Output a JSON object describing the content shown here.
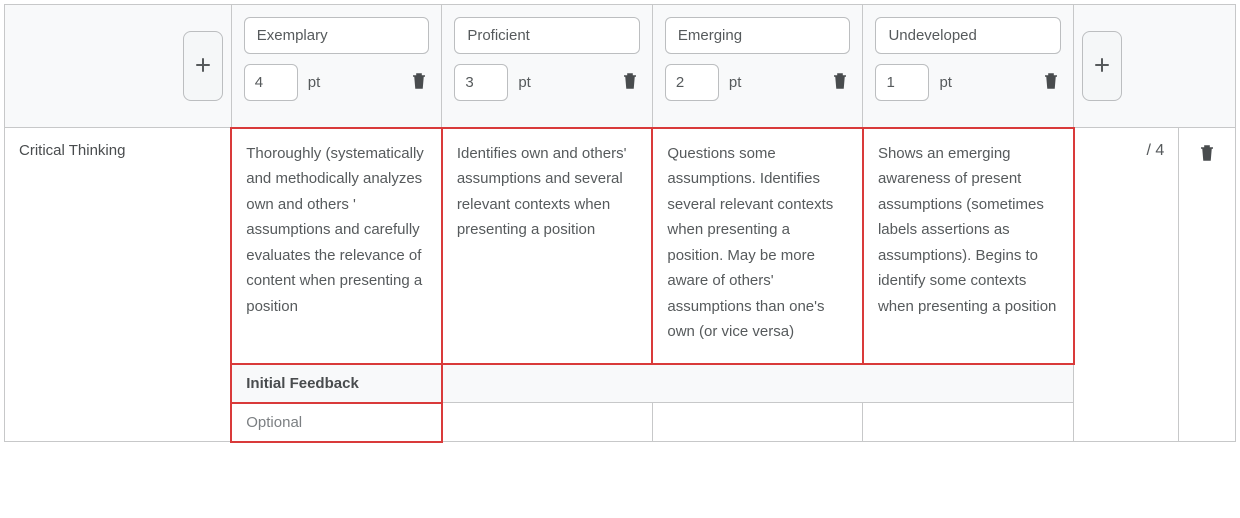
{
  "header": {
    "pt_label": "pt",
    "levels": [
      {
        "name": "Exemplary",
        "points": "4"
      },
      {
        "name": "Proficient",
        "points": "3"
      },
      {
        "name": "Emerging",
        "points": "2"
      },
      {
        "name": "Undeveloped",
        "points": "1"
      }
    ]
  },
  "criterion": {
    "name": "Critical Thinking",
    "out_of": "/ 4",
    "cells": [
      "Thoroughly (systematically and methodically analyzes own and others ' assumptions and carefully evaluates the relevance of content when presenting a position",
      "Identifies own and others' assumptions and several relevant contexts when presenting a position",
      "Questions some assumptions. Identifies several relevant contexts when presenting a position. May be more aware of others' assumptions than one's own (or vice versa)",
      "Shows an emerging awareness of present assumptions (sometimes labels assertions as assumptions). Begins to identify some contexts when presenting a position"
    ]
  },
  "feedback": {
    "label": "Initial Feedback",
    "placeholder": "Optional"
  }
}
